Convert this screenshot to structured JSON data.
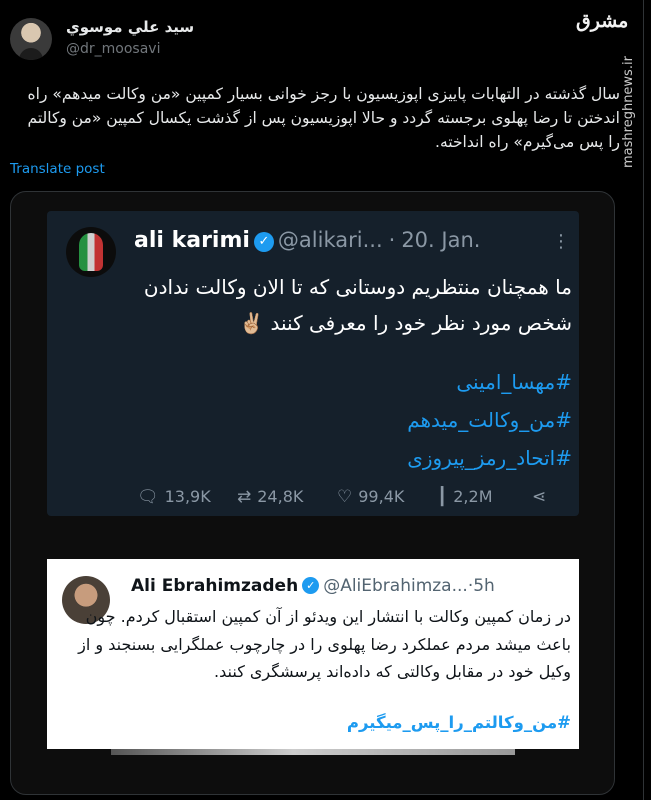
{
  "author": {
    "name": "سيد علي موسوي",
    "handle": "@dr_moosavi"
  },
  "brand": {
    "logo_text": "مشرق",
    "watermark": "mashreghnews.ir"
  },
  "post": {
    "text": "سال گذشته در التهابات پاییزی اپوزیسیون با رجز خوانی بسیار کمپین «من وکالت میدهم» راه اندختن تا رضا پهلوی برجسته گردد و حالا اپوزیسیون پس از گذشت یکسال کمپین «من وکالتم را پس می‌گیرم» راه انداخته.",
    "translate_label": "Translate post"
  },
  "embedded_tweet_1": {
    "name": "ali karimi",
    "verified_icon": "verified-badge-icon",
    "handle": "@alikari...",
    "separator": "·",
    "date": "20. Jan.",
    "more": "⋮",
    "text": "ما همچنان منتظریم دوستانی که تا الان وکالت ندادن شخص مورد نظر خود را معرفی کنند ✌🏼",
    "hashtags": [
      "#مهسا_امینی",
      "#من_وکالت_میدهم",
      "#اتحاد_رمز_پیروزی"
    ],
    "stats": {
      "replies": "13,9K",
      "reposts": "24,8K",
      "likes": "99,4K",
      "views": "2,2M"
    }
  },
  "embedded_tweet_2": {
    "name": "Ali Ebrahimzadeh",
    "verified_icon": "verified-badge-icon",
    "handle": "@AliEbrahimza...",
    "separator": "·",
    "time": "5h",
    "text": "در زمان کمپین وکالت با انتشار این ویدئو از آن کمپین استقبال کردم. چون باعث میشد مردم عملکرد رضا پهلوی را در چارچوب عملگرایی بسنجند و از وکیل خود در مقابل وکالتی که داده‌اند پرسشگری کنند.",
    "hashtag": "#من_وکالتم_را_پس_میگیرم"
  },
  "colors": {
    "background": "#000000",
    "link": "#1d9bf0",
    "dim_card": "#15202b"
  }
}
